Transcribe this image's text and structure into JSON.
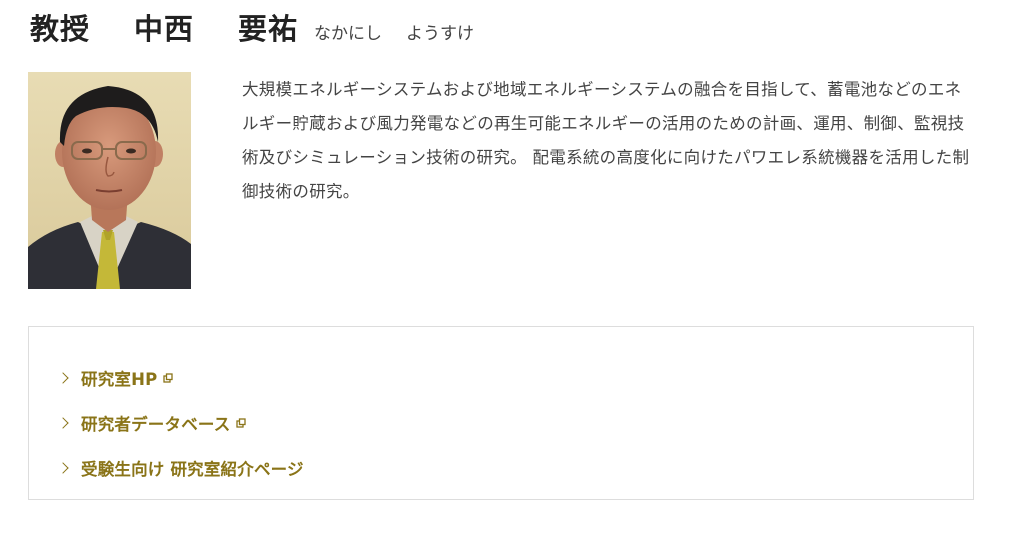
{
  "profile": {
    "title": "教授",
    "surname": "中西",
    "given_name": "要祐",
    "kana_surname": "なかにし",
    "kana_given": "ようすけ",
    "photo_icon": "portrait-photo",
    "description": "大規模エネルギーシステムおよび地域エネルギーシステムの融合を目指して、蓄電池などのエネルギー貯蔵および風力発電などの再生可能エネルギーの活用のための計画、運用、制御、監視技術及びシミュレーション技術の研究。 配電系統の高度化に向けたパワエレ系統機器を活用した制御技術の研究。"
  },
  "links": [
    {
      "label": "研究室HP",
      "external": true,
      "icon": "external-link-icon"
    },
    {
      "label": "研究者データベース",
      "external": true,
      "icon": "external-link-icon"
    },
    {
      "label": "受験生向け 研究室紹介ページ",
      "external": false
    }
  ],
  "colors": {
    "link": "#8a7418",
    "text": "#444444",
    "border": "#dddddd"
  }
}
